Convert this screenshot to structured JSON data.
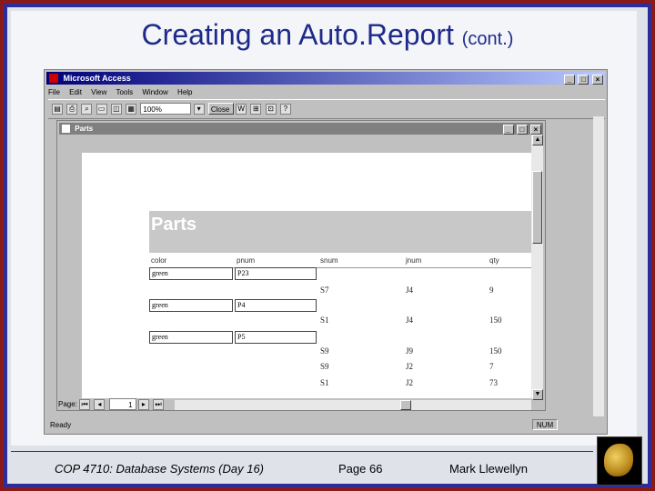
{
  "slide": {
    "title": "Creating an Auto.Report",
    "title_suffix": "(cont.)"
  },
  "app": {
    "title": "Microsoft Access",
    "menu": [
      "File",
      "Edit",
      "View",
      "Tools",
      "Window",
      "Help"
    ],
    "toolbar": {
      "zoom": "100%",
      "close": "Close"
    },
    "status": "Ready",
    "status_indicator": "NUM"
  },
  "report": {
    "window_title": "Parts",
    "heading": "Parts",
    "columns": [
      "color",
      "pnum",
      "snum",
      "jnum",
      "qty"
    ],
    "groups": [
      {
        "color": "green",
        "pnum": "P23",
        "rows": [
          {
            "snum": "S7",
            "jnum": "J4",
            "qty": "9"
          }
        ]
      },
      {
        "color": "green",
        "pnum": "P4",
        "rows": [
          {
            "snum": "S1",
            "jnum": "J4",
            "qty": "150"
          }
        ]
      },
      {
        "color": "green",
        "pnum": "P5",
        "rows": [
          {
            "snum": "S9",
            "jnum": "J9",
            "qty": "150"
          },
          {
            "snum": "S9",
            "jnum": "J2",
            "qty": "7"
          },
          {
            "snum": "S1",
            "jnum": "J2",
            "qty": "73"
          }
        ]
      }
    ],
    "page_label": "Page:",
    "page_number": "1"
  },
  "footer": {
    "course": "COP 4710: Database Systems  (Day 16)",
    "page": "Page 66",
    "author": "Mark Llewellyn"
  },
  "colors": {
    "title": "#1e2a8a",
    "frame_outer": "#8a1a1a",
    "frame_blue": "#2a2d9a"
  }
}
